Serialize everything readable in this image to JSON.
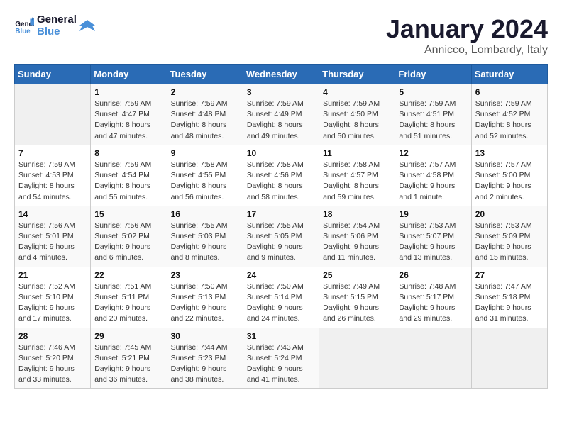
{
  "header": {
    "logo_line1": "General",
    "logo_line2": "Blue",
    "month": "January 2024",
    "location": "Annicco, Lombardy, Italy"
  },
  "weekdays": [
    "Sunday",
    "Monday",
    "Tuesday",
    "Wednesday",
    "Thursday",
    "Friday",
    "Saturday"
  ],
  "weeks": [
    [
      {
        "day": "",
        "empty": true
      },
      {
        "day": "1",
        "sunrise": "7:59 AM",
        "sunset": "4:47 PM",
        "daylight": "8 hours and 47 minutes."
      },
      {
        "day": "2",
        "sunrise": "7:59 AM",
        "sunset": "4:48 PM",
        "daylight": "8 hours and 48 minutes."
      },
      {
        "day": "3",
        "sunrise": "7:59 AM",
        "sunset": "4:49 PM",
        "daylight": "8 hours and 49 minutes."
      },
      {
        "day": "4",
        "sunrise": "7:59 AM",
        "sunset": "4:50 PM",
        "daylight": "8 hours and 50 minutes."
      },
      {
        "day": "5",
        "sunrise": "7:59 AM",
        "sunset": "4:51 PM",
        "daylight": "8 hours and 51 minutes."
      },
      {
        "day": "6",
        "sunrise": "7:59 AM",
        "sunset": "4:52 PM",
        "daylight": "8 hours and 52 minutes."
      }
    ],
    [
      {
        "day": "7",
        "sunrise": "7:59 AM",
        "sunset": "4:53 PM",
        "daylight": "8 hours and 54 minutes."
      },
      {
        "day": "8",
        "sunrise": "7:59 AM",
        "sunset": "4:54 PM",
        "daylight": "8 hours and 55 minutes."
      },
      {
        "day": "9",
        "sunrise": "7:58 AM",
        "sunset": "4:55 PM",
        "daylight": "8 hours and 56 minutes."
      },
      {
        "day": "10",
        "sunrise": "7:58 AM",
        "sunset": "4:56 PM",
        "daylight": "8 hours and 58 minutes."
      },
      {
        "day": "11",
        "sunrise": "7:58 AM",
        "sunset": "4:57 PM",
        "daylight": "8 hours and 59 minutes."
      },
      {
        "day": "12",
        "sunrise": "7:57 AM",
        "sunset": "4:58 PM",
        "daylight": "9 hours and 1 minute."
      },
      {
        "day": "13",
        "sunrise": "7:57 AM",
        "sunset": "5:00 PM",
        "daylight": "9 hours and 2 minutes."
      }
    ],
    [
      {
        "day": "14",
        "sunrise": "7:56 AM",
        "sunset": "5:01 PM",
        "daylight": "9 hours and 4 minutes."
      },
      {
        "day": "15",
        "sunrise": "7:56 AM",
        "sunset": "5:02 PM",
        "daylight": "9 hours and 6 minutes."
      },
      {
        "day": "16",
        "sunrise": "7:55 AM",
        "sunset": "5:03 PM",
        "daylight": "9 hours and 8 minutes."
      },
      {
        "day": "17",
        "sunrise": "7:55 AM",
        "sunset": "5:05 PM",
        "daylight": "9 hours and 9 minutes."
      },
      {
        "day": "18",
        "sunrise": "7:54 AM",
        "sunset": "5:06 PM",
        "daylight": "9 hours and 11 minutes."
      },
      {
        "day": "19",
        "sunrise": "7:53 AM",
        "sunset": "5:07 PM",
        "daylight": "9 hours and 13 minutes."
      },
      {
        "day": "20",
        "sunrise": "7:53 AM",
        "sunset": "5:09 PM",
        "daylight": "9 hours and 15 minutes."
      }
    ],
    [
      {
        "day": "21",
        "sunrise": "7:52 AM",
        "sunset": "5:10 PM",
        "daylight": "9 hours and 17 minutes."
      },
      {
        "day": "22",
        "sunrise": "7:51 AM",
        "sunset": "5:11 PM",
        "daylight": "9 hours and 20 minutes."
      },
      {
        "day": "23",
        "sunrise": "7:50 AM",
        "sunset": "5:13 PM",
        "daylight": "9 hours and 22 minutes."
      },
      {
        "day": "24",
        "sunrise": "7:50 AM",
        "sunset": "5:14 PM",
        "daylight": "9 hours and 24 minutes."
      },
      {
        "day": "25",
        "sunrise": "7:49 AM",
        "sunset": "5:15 PM",
        "daylight": "9 hours and 26 minutes."
      },
      {
        "day": "26",
        "sunrise": "7:48 AM",
        "sunset": "5:17 PM",
        "daylight": "9 hours and 29 minutes."
      },
      {
        "day": "27",
        "sunrise": "7:47 AM",
        "sunset": "5:18 PM",
        "daylight": "9 hours and 31 minutes."
      }
    ],
    [
      {
        "day": "28",
        "sunrise": "7:46 AM",
        "sunset": "5:20 PM",
        "daylight": "9 hours and 33 minutes."
      },
      {
        "day": "29",
        "sunrise": "7:45 AM",
        "sunset": "5:21 PM",
        "daylight": "9 hours and 36 minutes."
      },
      {
        "day": "30",
        "sunrise": "7:44 AM",
        "sunset": "5:23 PM",
        "daylight": "9 hours and 38 minutes."
      },
      {
        "day": "31",
        "sunrise": "7:43 AM",
        "sunset": "5:24 PM",
        "daylight": "9 hours and 41 minutes."
      },
      {
        "day": "",
        "empty": true
      },
      {
        "day": "",
        "empty": true
      },
      {
        "day": "",
        "empty": true
      }
    ]
  ]
}
